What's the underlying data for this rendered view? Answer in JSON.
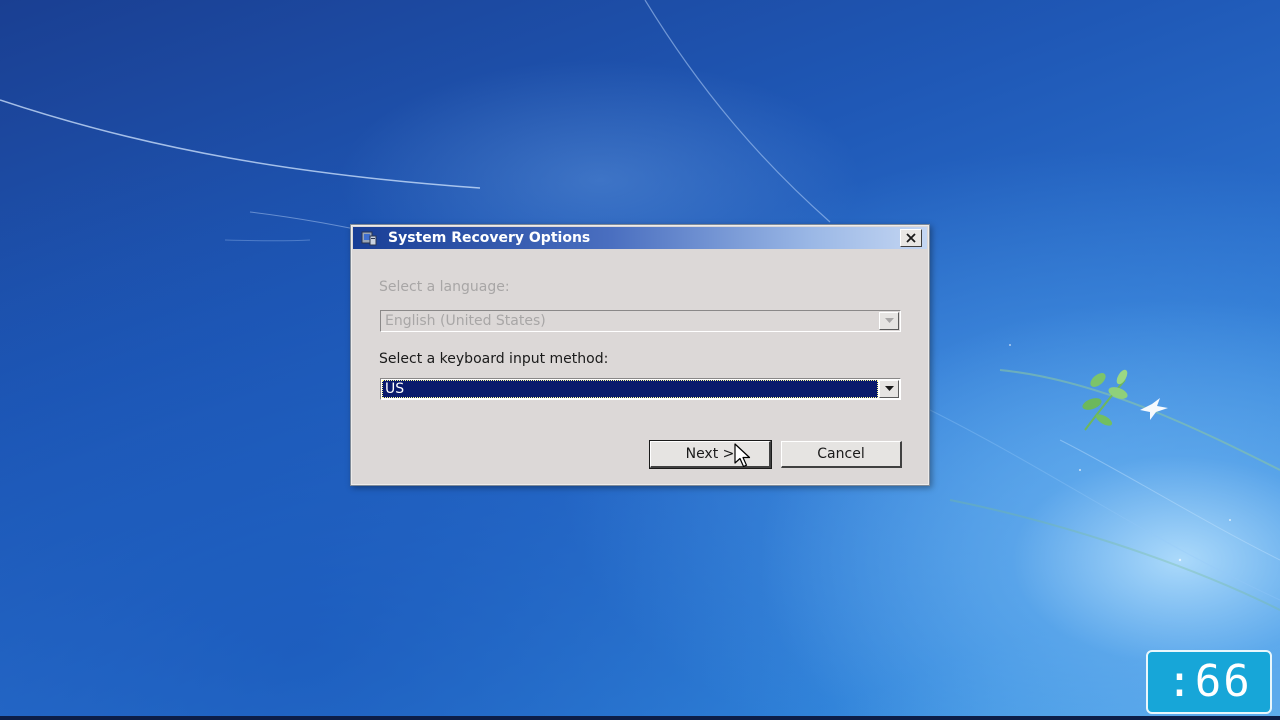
{
  "dialog": {
    "title": "System Recovery Options",
    "title_icon": "recovery-monitor-icon",
    "close_icon": "close-icon",
    "language": {
      "label": "Select a language:",
      "value": "English (United States)",
      "enabled": false
    },
    "keyboard": {
      "label": "Select a keyboard input method:",
      "value": "US",
      "enabled": true
    },
    "buttons": {
      "next": "Next >",
      "cancel": "Cancel"
    }
  },
  "overlay": {
    "timer_text": ":66"
  },
  "colors": {
    "titlebar_start": "#183e96",
    "titlebar_end": "#c4d6f2",
    "dialog_bg": "#dcd8d7",
    "selection": "#0a1b6c",
    "timer_bg": "#17a6d8"
  }
}
